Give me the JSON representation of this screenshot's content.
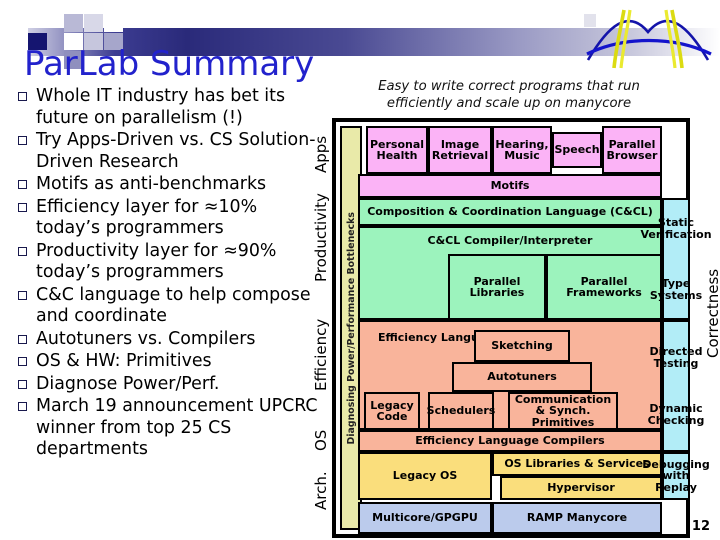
{
  "slide": {
    "title": "ParLab Summary",
    "page_number": "12"
  },
  "bullets": [
    "Whole IT industry has bet its future on parallelism (!)",
    "Try Apps-Driven vs. CS Solution-Driven Research",
    "Motifs as anti-benchmarks",
    "Efficiency layer for ≈10% today’s programmers",
    "Productivity layer for ≈90% today’s programmers",
    "C&C language to help compose and coordinate",
    "Autotuners vs. Compilers",
    "OS & HW: Primitives",
    "Diagnose Power/Perf.",
    "March 19 announcement UPCRC winner from top 25 CS departments"
  ],
  "diagram": {
    "subtitle": "Easy to write correct programs that run efficiently and scale up on manycore",
    "left_layer_labels": [
      "Apps",
      "Productivity",
      "Efficiency",
      "OS",
      "Arch."
    ],
    "diagnosis_column": "Diagnosing Power/Performance Bottlenecks",
    "right_label": "Correctness",
    "apps": [
      "Personal Health",
      "Image Retrieval",
      "Hearing, Music",
      "Speech",
      "Parallel Browser"
    ],
    "motifs": "Motifs",
    "productivity": {
      "ccl": "Composition & Coordination Language (C&CL)",
      "compiler": "C&CL Compiler/Interpreter",
      "libraries": "Parallel Libraries",
      "frameworks": "Parallel Frameworks"
    },
    "efficiency": {
      "languages": "Efficiency Languages",
      "sketching": "Sketching",
      "autotuners": "Autotuners",
      "legacy_code": "Legacy Code",
      "schedulers": "Schedulers",
      "comm": "Communication & Synch. Primitives",
      "compilers": "Efficiency Language Compilers"
    },
    "os": {
      "legacy_os": "Legacy OS",
      "libraries": "OS Libraries & Services",
      "hypervisor": "Hypervisor"
    },
    "arch": {
      "multicore": "Multicore/GPGPU",
      "ramp": "RAMP Manycore"
    },
    "correctness_column": [
      "Static Verification",
      "Type Systems",
      "Directed Testing",
      "Dynamic Checking",
      "Debugging with Replay"
    ]
  },
  "colors": {
    "title": "#2222cc",
    "apps": "#fbb3f6",
    "productivity": "#9cf3bd",
    "efficiency": "#f9b49b",
    "os": "#fade7c",
    "arch": "#bbcbec",
    "correctness": "#b2edf7",
    "diagnosis": "#e9eaa9"
  }
}
